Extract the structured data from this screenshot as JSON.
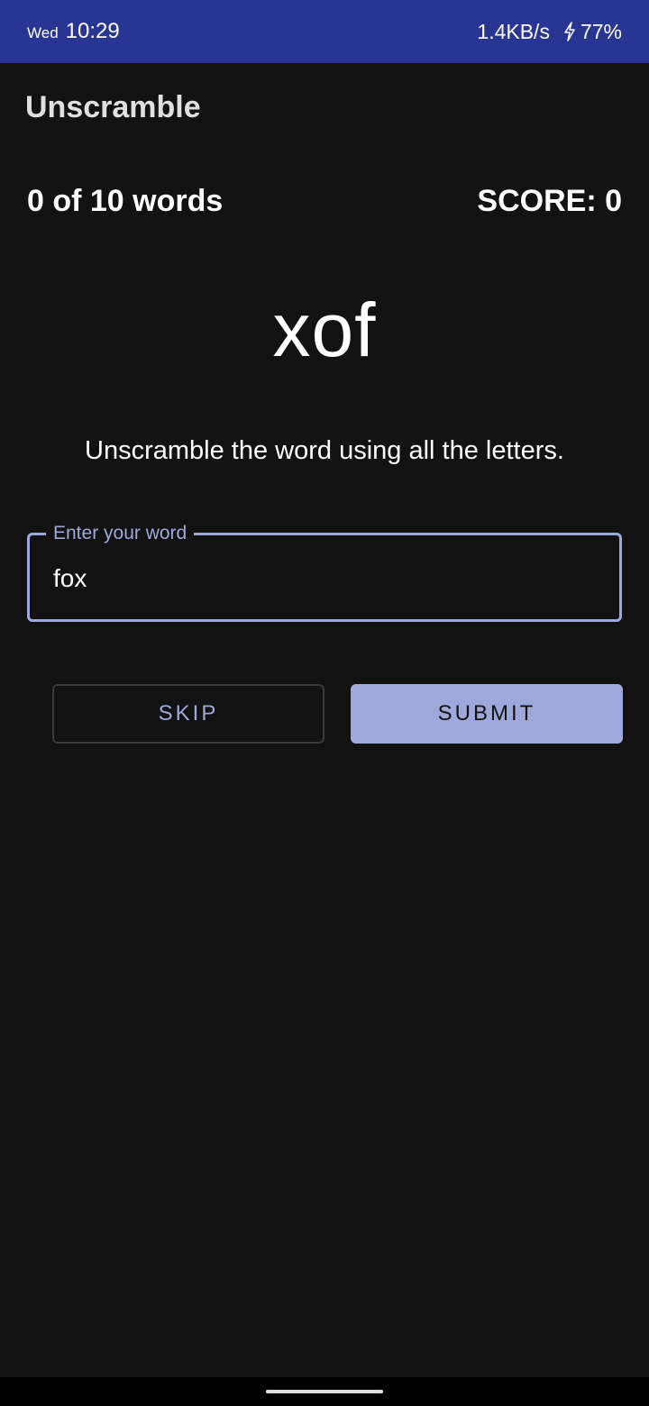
{
  "status_bar": {
    "day": "Wed",
    "time": "10:29",
    "network_speed": "1.4KB/s",
    "battery": "77%",
    "battery_icon": "charging-bolt-icon",
    "background_color": "#283593"
  },
  "app_bar": {
    "title": "Unscramble"
  },
  "game": {
    "word_count": "0 of 10 words",
    "score": "SCORE: 0",
    "scrambled_word": "xof",
    "instructions": "Unscramble the word using all the letters."
  },
  "input": {
    "label": "Enter your word",
    "value": "fox",
    "accent_color": "#9fa8da"
  },
  "buttons": {
    "skip_label": "SKIP",
    "submit_label": "SUBMIT"
  },
  "nav_bar": {
    "indicator": "home-indicator"
  }
}
